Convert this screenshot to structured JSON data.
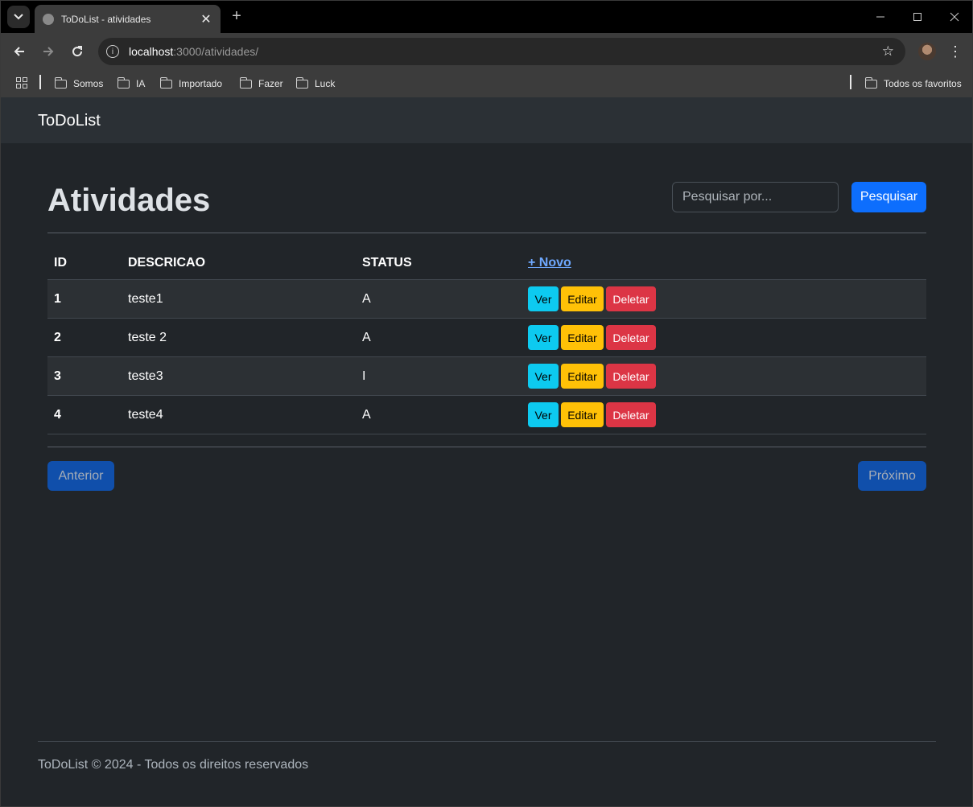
{
  "browser": {
    "tab_title": "ToDoList - atividades",
    "tab_close": "✕",
    "new_tab": "+",
    "url_host": "localhost",
    "url_rest": ":3000/atividades/",
    "bookmarks": [
      "Somos",
      "IA",
      "Importado",
      "Fazer",
      "Luck"
    ],
    "all_bookmarks": "Todos os favoritos"
  },
  "navbar": {
    "brand": "ToDoList"
  },
  "main": {
    "title": "Atividades",
    "search_placeholder": "Pesquisar por...",
    "search_button": "Pesquisar",
    "table": {
      "headers": {
        "id": "ID",
        "descricao": "DESCRICAO",
        "status": "STATUS",
        "novo": "+ Novo"
      },
      "rows": [
        {
          "id": "1",
          "descricao": "teste1",
          "status": "A"
        },
        {
          "id": "2",
          "descricao": "teste 2",
          "status": "A"
        },
        {
          "id": "3",
          "descricao": "teste3",
          "status": "I"
        },
        {
          "id": "4",
          "descricao": "teste4",
          "status": "A"
        }
      ],
      "actions": {
        "ver": "Ver",
        "editar": "Editar",
        "deletar": "Deletar"
      }
    },
    "pagination": {
      "prev": "Anterior",
      "next": "Próximo"
    }
  },
  "footer": {
    "text": "ToDoList © 2024 - Todos os direitos reservados"
  },
  "colors": {
    "primary": "#0d6efd",
    "info": "#0dcaf0",
    "warning": "#ffc107",
    "danger": "#dc3545",
    "link": "#6ea8fe",
    "background": "#212529"
  }
}
